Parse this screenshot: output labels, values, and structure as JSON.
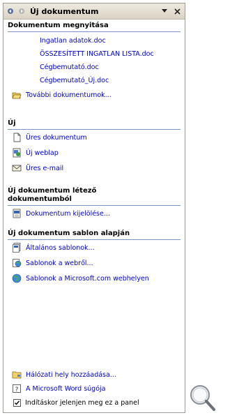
{
  "panel": {
    "title": "Új dokumentum",
    "nav_back_icon": "back-arrow-icon",
    "nav_forward_icon": "forward-arrow-icon",
    "dropdown_icon": "dropdown-arrow-icon",
    "close_icon": "close-icon"
  },
  "open_section": {
    "heading": "Dokumentum megnyitása",
    "files": [
      "Ingatlan adatok.doc",
      "ÖSSZESÍTETT INGATLAN LISTA.doc",
      "Cégbemutató.doc",
      "Cégbemutató_Új.doc"
    ],
    "more_label": "További dokumentumok..."
  },
  "new_section": {
    "heading": "Új",
    "items": [
      {
        "label": "Üres dokumentum",
        "icon": "blank-document-icon"
      },
      {
        "label": "Új weblap",
        "icon": "web-page-icon"
      },
      {
        "label": "Üres e-mail",
        "icon": "email-envelope-icon"
      }
    ]
  },
  "existing_section": {
    "heading_line1": "Új dokumentum létező",
    "heading_line2": "dokumentumból",
    "item_label": "Dokumentum kijelölése..."
  },
  "template_section": {
    "heading": "Új dokumentum sablon alapján",
    "items": [
      {
        "label": "Általános sablonok...",
        "icon": "templates-icon"
      },
      {
        "label": "Sablonok a webről...",
        "icon": "web-templates-icon"
      },
      {
        "label": "Sablonok a Microsoft.com webhelyen",
        "icon": "globe-icon"
      }
    ]
  },
  "footer": {
    "add_network_label": "Hálózati hely hozzáadása...",
    "help_label": "A Microsoft Word súgója",
    "startup_checkbox_label": "Indításkor jelenjen meg ez a panel",
    "startup_checked": true
  },
  "colors": {
    "link": "#0000cc",
    "section_rule": "#7b96c6",
    "title_bg": "#d9d3c3"
  }
}
